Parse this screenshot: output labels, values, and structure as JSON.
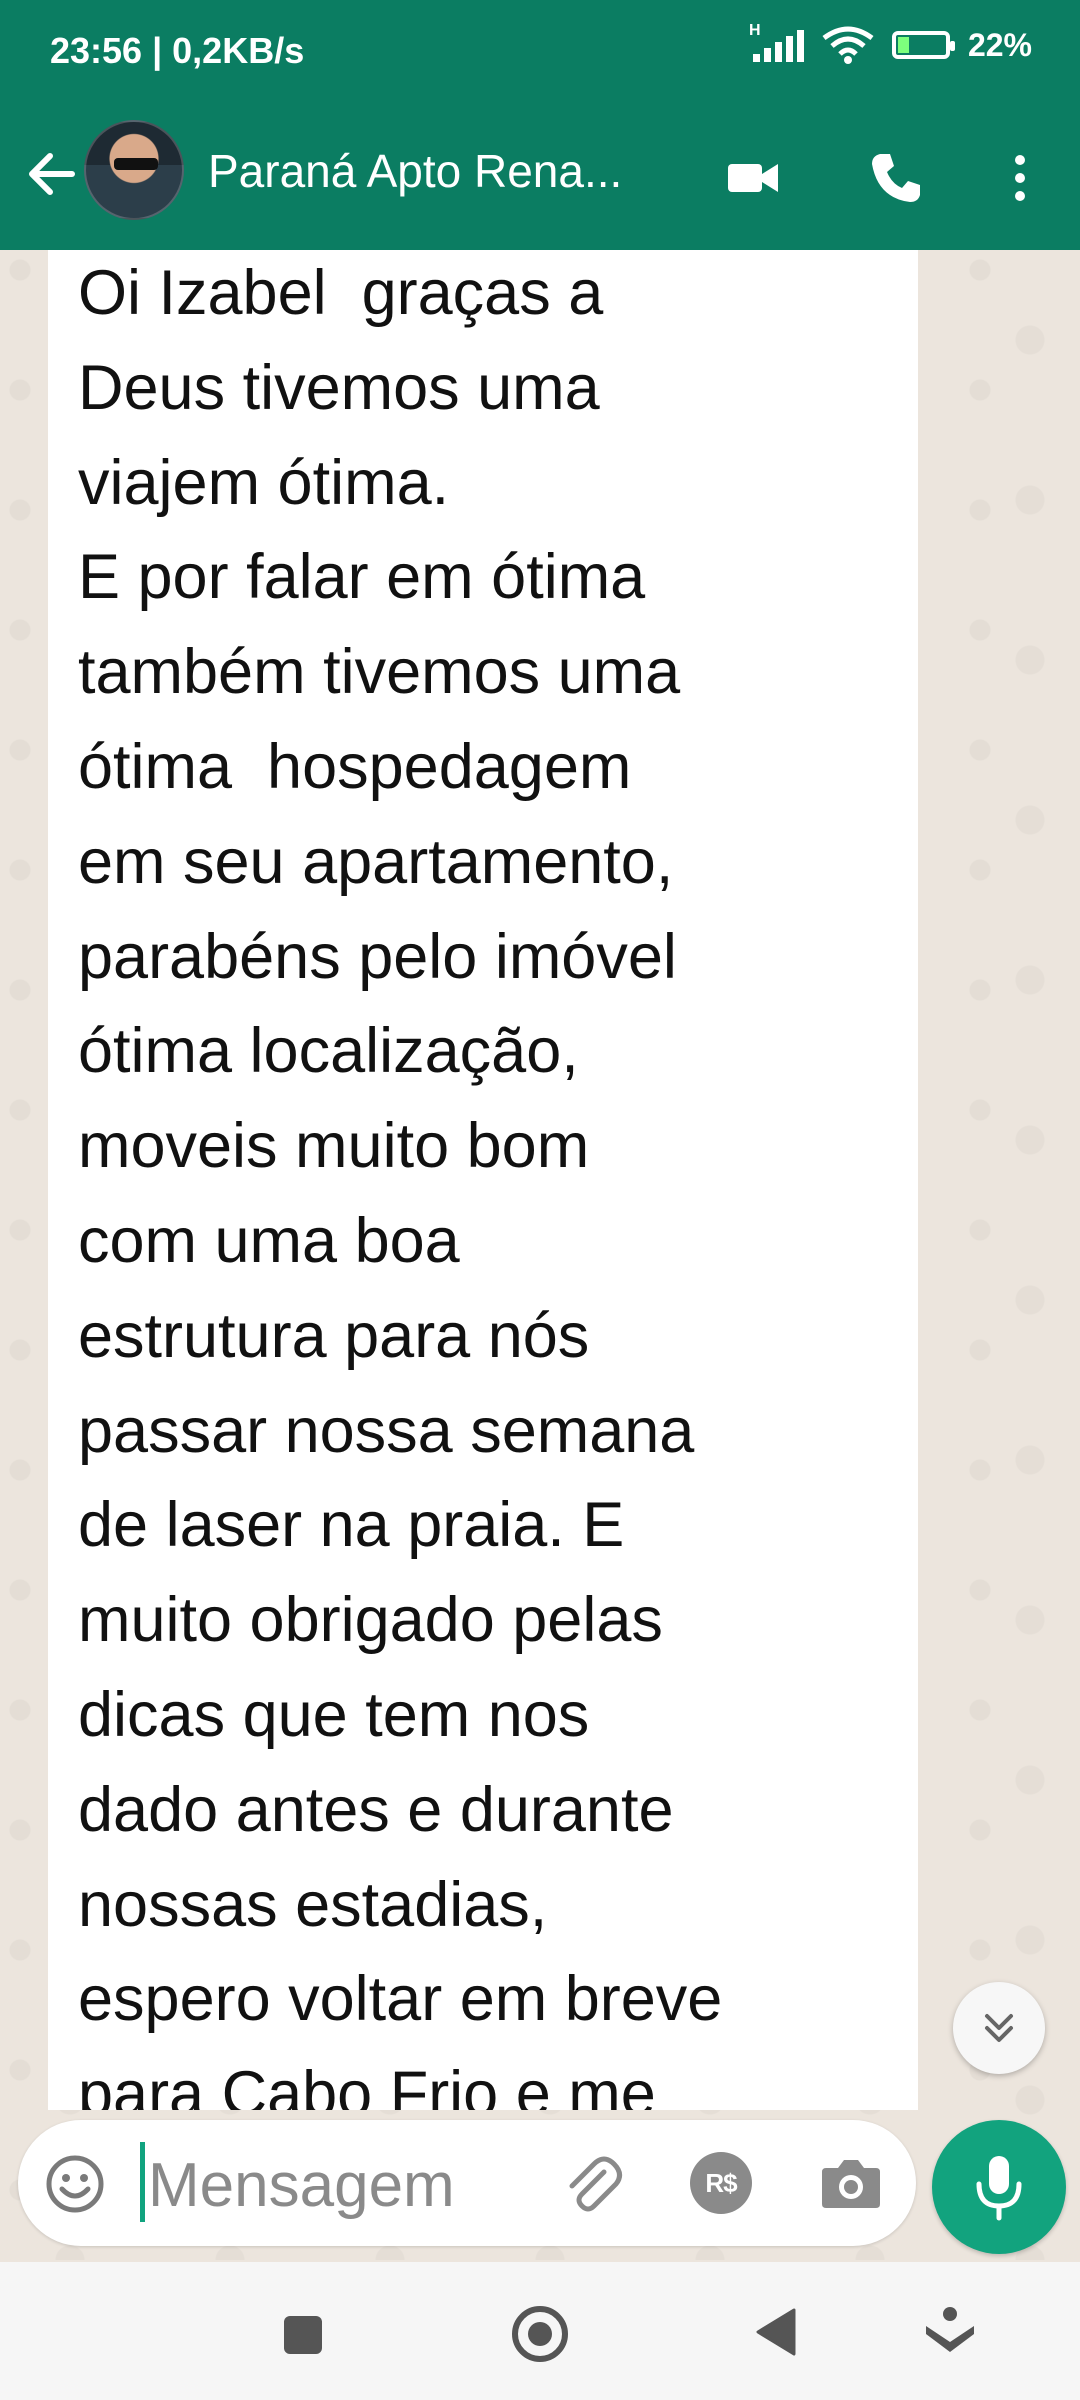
{
  "status_bar": {
    "time_speed": "23:56 | 0,2KB/s",
    "network_type": "H",
    "battery_percent": "22%"
  },
  "header": {
    "contact_name": "Paraná Apto Rena...",
    "icons": [
      "back-arrow-icon",
      "video-call-icon",
      "phone-icon",
      "more-vert-icon"
    ]
  },
  "message": {
    "lines": [
      "Oi Izabel  graças a",
      "Deus tivemos uma",
      "viajem ótima.",
      "E por falar em ótima",
      "também tivemos uma",
      "ótima  hospedagem",
      "em seu apartamento,",
      "parabéns pelo imóvel",
      "ótima localização,",
      "moveis muito bom",
      "com uma boa",
      "estrutura para nós",
      "passar nossa semana",
      "de laser na praia. E",
      "muito obrigado pelas",
      "dicas que tem nos",
      "dado antes e durante",
      "nossas estadias,",
      "espero voltar em breve",
      "para Cabo Frio e me"
    ]
  },
  "composer": {
    "placeholder": "Mensagem",
    "pay_label": "R$"
  },
  "colors": {
    "header": "#0b7d62",
    "accent": "#12a37e",
    "wallpaper": "#ece5dd"
  }
}
